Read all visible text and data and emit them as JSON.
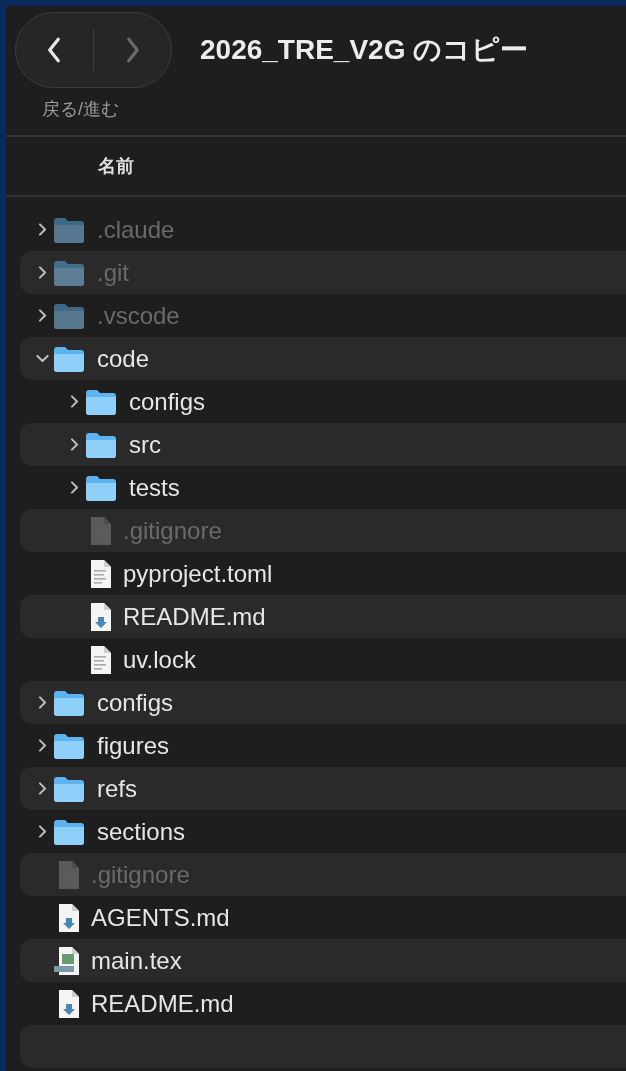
{
  "window": {
    "title": "2026_TRE_V2G のコピー",
    "nav_caption": "戻る/進む",
    "back_enabled": true,
    "forward_enabled": false
  },
  "columns": [
    {
      "label": "名前"
    }
  ],
  "items": [
    {
      "name": ".claude",
      "kind": "folder",
      "hidden": true,
      "expanded": false
    },
    {
      "name": ".git",
      "kind": "folder",
      "hidden": true,
      "expanded": false
    },
    {
      "name": ".vscode",
      "kind": "folder",
      "hidden": true,
      "expanded": false
    },
    {
      "name": "code",
      "kind": "folder",
      "hidden": false,
      "expanded": true,
      "children": [
        {
          "name": "configs",
          "kind": "folder",
          "hidden": false,
          "expanded": false
        },
        {
          "name": "src",
          "kind": "folder",
          "hidden": false,
          "expanded": false
        },
        {
          "name": "tests",
          "kind": "folder",
          "hidden": false,
          "expanded": false
        },
        {
          "name": ".gitignore",
          "kind": "unknown",
          "hidden": true
        },
        {
          "name": "pyproject.toml",
          "kind": "text",
          "hidden": false
        },
        {
          "name": "README.md",
          "kind": "markdown",
          "hidden": false
        },
        {
          "name": "uv.lock",
          "kind": "text",
          "hidden": false
        }
      ]
    },
    {
      "name": "configs",
      "kind": "folder",
      "hidden": false,
      "expanded": false
    },
    {
      "name": "figures",
      "kind": "folder",
      "hidden": false,
      "expanded": false
    },
    {
      "name": "refs",
      "kind": "folder",
      "hidden": false,
      "expanded": false
    },
    {
      "name": "sections",
      "kind": "folder",
      "hidden": false,
      "expanded": false
    },
    {
      "name": ".gitignore",
      "kind": "unknown",
      "hidden": true
    },
    {
      "name": "AGENTS.md",
      "kind": "markdown",
      "hidden": false
    },
    {
      "name": "main.tex",
      "kind": "tex",
      "hidden": false
    },
    {
      "name": "README.md",
      "kind": "markdown",
      "hidden": false
    }
  ]
}
